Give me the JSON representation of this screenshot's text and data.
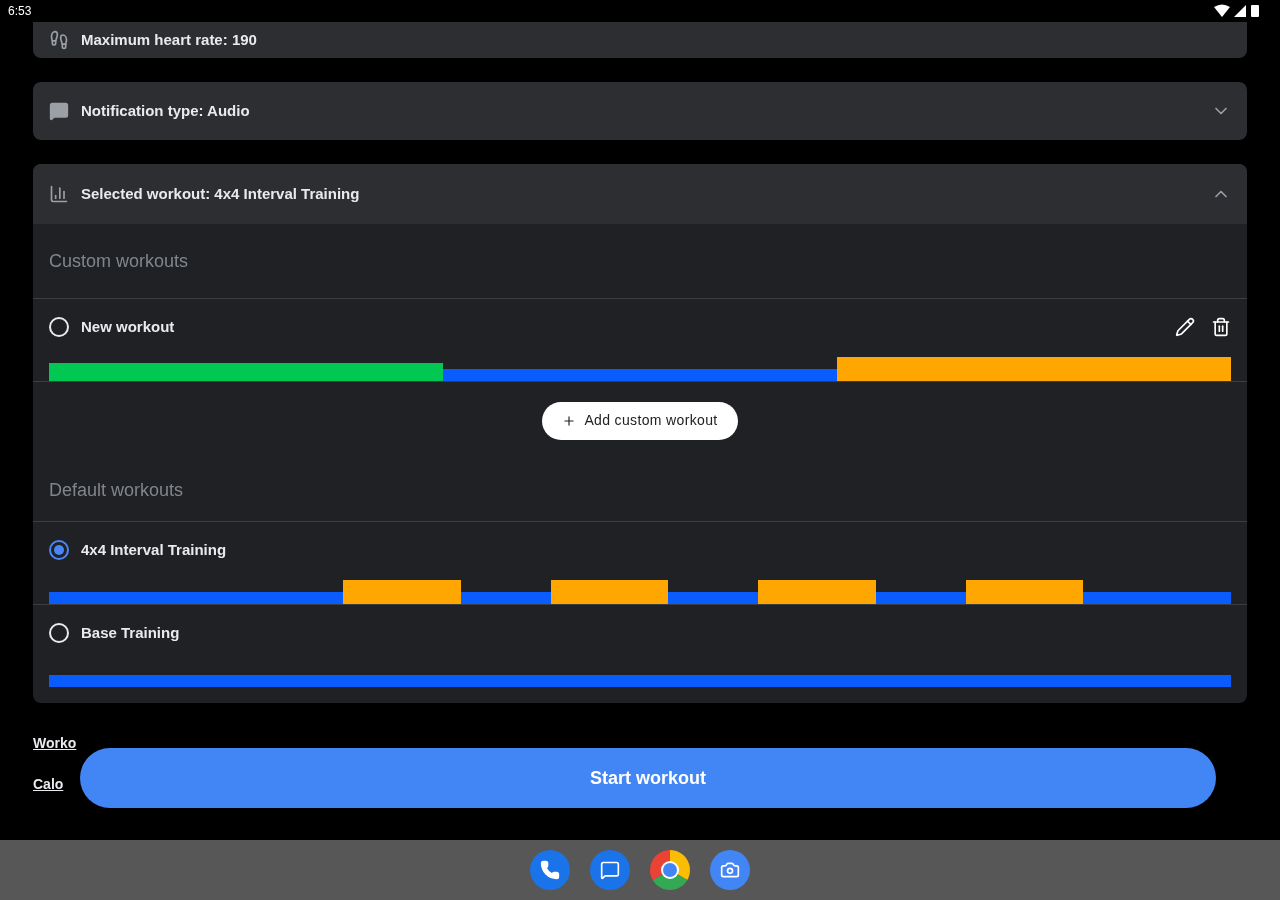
{
  "status_bar": {
    "time": "6:53"
  },
  "settings": [
    {
      "kind": "heart",
      "label": "Maximum heart rate: 190",
      "chevron": false
    },
    {
      "kind": "chat",
      "label": "Notification type: Audio",
      "chevron": true
    }
  ],
  "workout_panel": {
    "label": "Selected workout: 4x4 Interval Training",
    "expanded": true,
    "custom_title": "Custom workouts",
    "custom": [
      {
        "name": "New workout",
        "selected": false,
        "editable": true,
        "segments": [
          {
            "kind": "zone_low",
            "color": "#00c853"
          },
          {
            "kind": "zone_mid",
            "color": "#0a5cff"
          },
          {
            "kind": "zone_high",
            "color": "#ffa600"
          }
        ]
      }
    ],
    "add_button": "Add custom workout",
    "default_title": "Default workouts",
    "defaults": [
      {
        "name": "4x4 Interval Training",
        "selected": true,
        "editable": false,
        "segments": [
          {
            "kind": "warmup",
            "color": "#0a5cff"
          },
          {
            "kind": "interval",
            "color": "#ffa600"
          },
          {
            "kind": "recovery",
            "color": "#0a5cff"
          },
          {
            "kind": "interval",
            "color": "#ffa600"
          },
          {
            "kind": "recovery",
            "color": "#0a5cff"
          },
          {
            "kind": "interval",
            "color": "#ffa600"
          },
          {
            "kind": "recovery",
            "color": "#0a5cff"
          },
          {
            "kind": "interval",
            "color": "#ffa600"
          },
          {
            "kind": "cooldown",
            "color": "#0a5cff"
          }
        ]
      },
      {
        "name": "Base Training",
        "selected": false,
        "editable": false,
        "segments": [
          {
            "kind": "steady",
            "color": "#0a5cff"
          }
        ]
      }
    ]
  },
  "links": [
    "Worko",
    "Calo"
  ],
  "start_button": "Start workout"
}
